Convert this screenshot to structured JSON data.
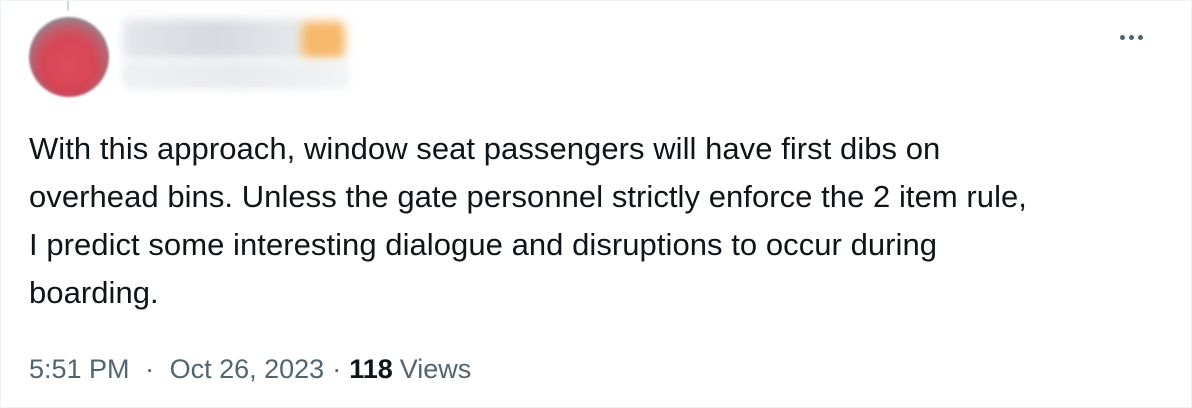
{
  "tweet": {
    "author": {
      "avatar_icon": "avatar-blurred",
      "name_redacted": true,
      "handle_redacted": true
    },
    "more_icon": "more-horizontal-icon",
    "text_lines": [
      "With this approach, window seat passengers will have first dibs on",
      "overhead bins. Unless the gate personnel strictly enforce the 2 item rule,",
      "I predict some interesting dialogue and disruptions to occur during",
      "boarding."
    ],
    "time": "5:51 PM",
    "separator": "·",
    "date": "Oct 26, 2023",
    "views_count": "118",
    "views_label": "Views"
  },
  "colors": {
    "text_primary": "#0f1419",
    "text_secondary": "#536471",
    "border": "#eff3f4"
  }
}
